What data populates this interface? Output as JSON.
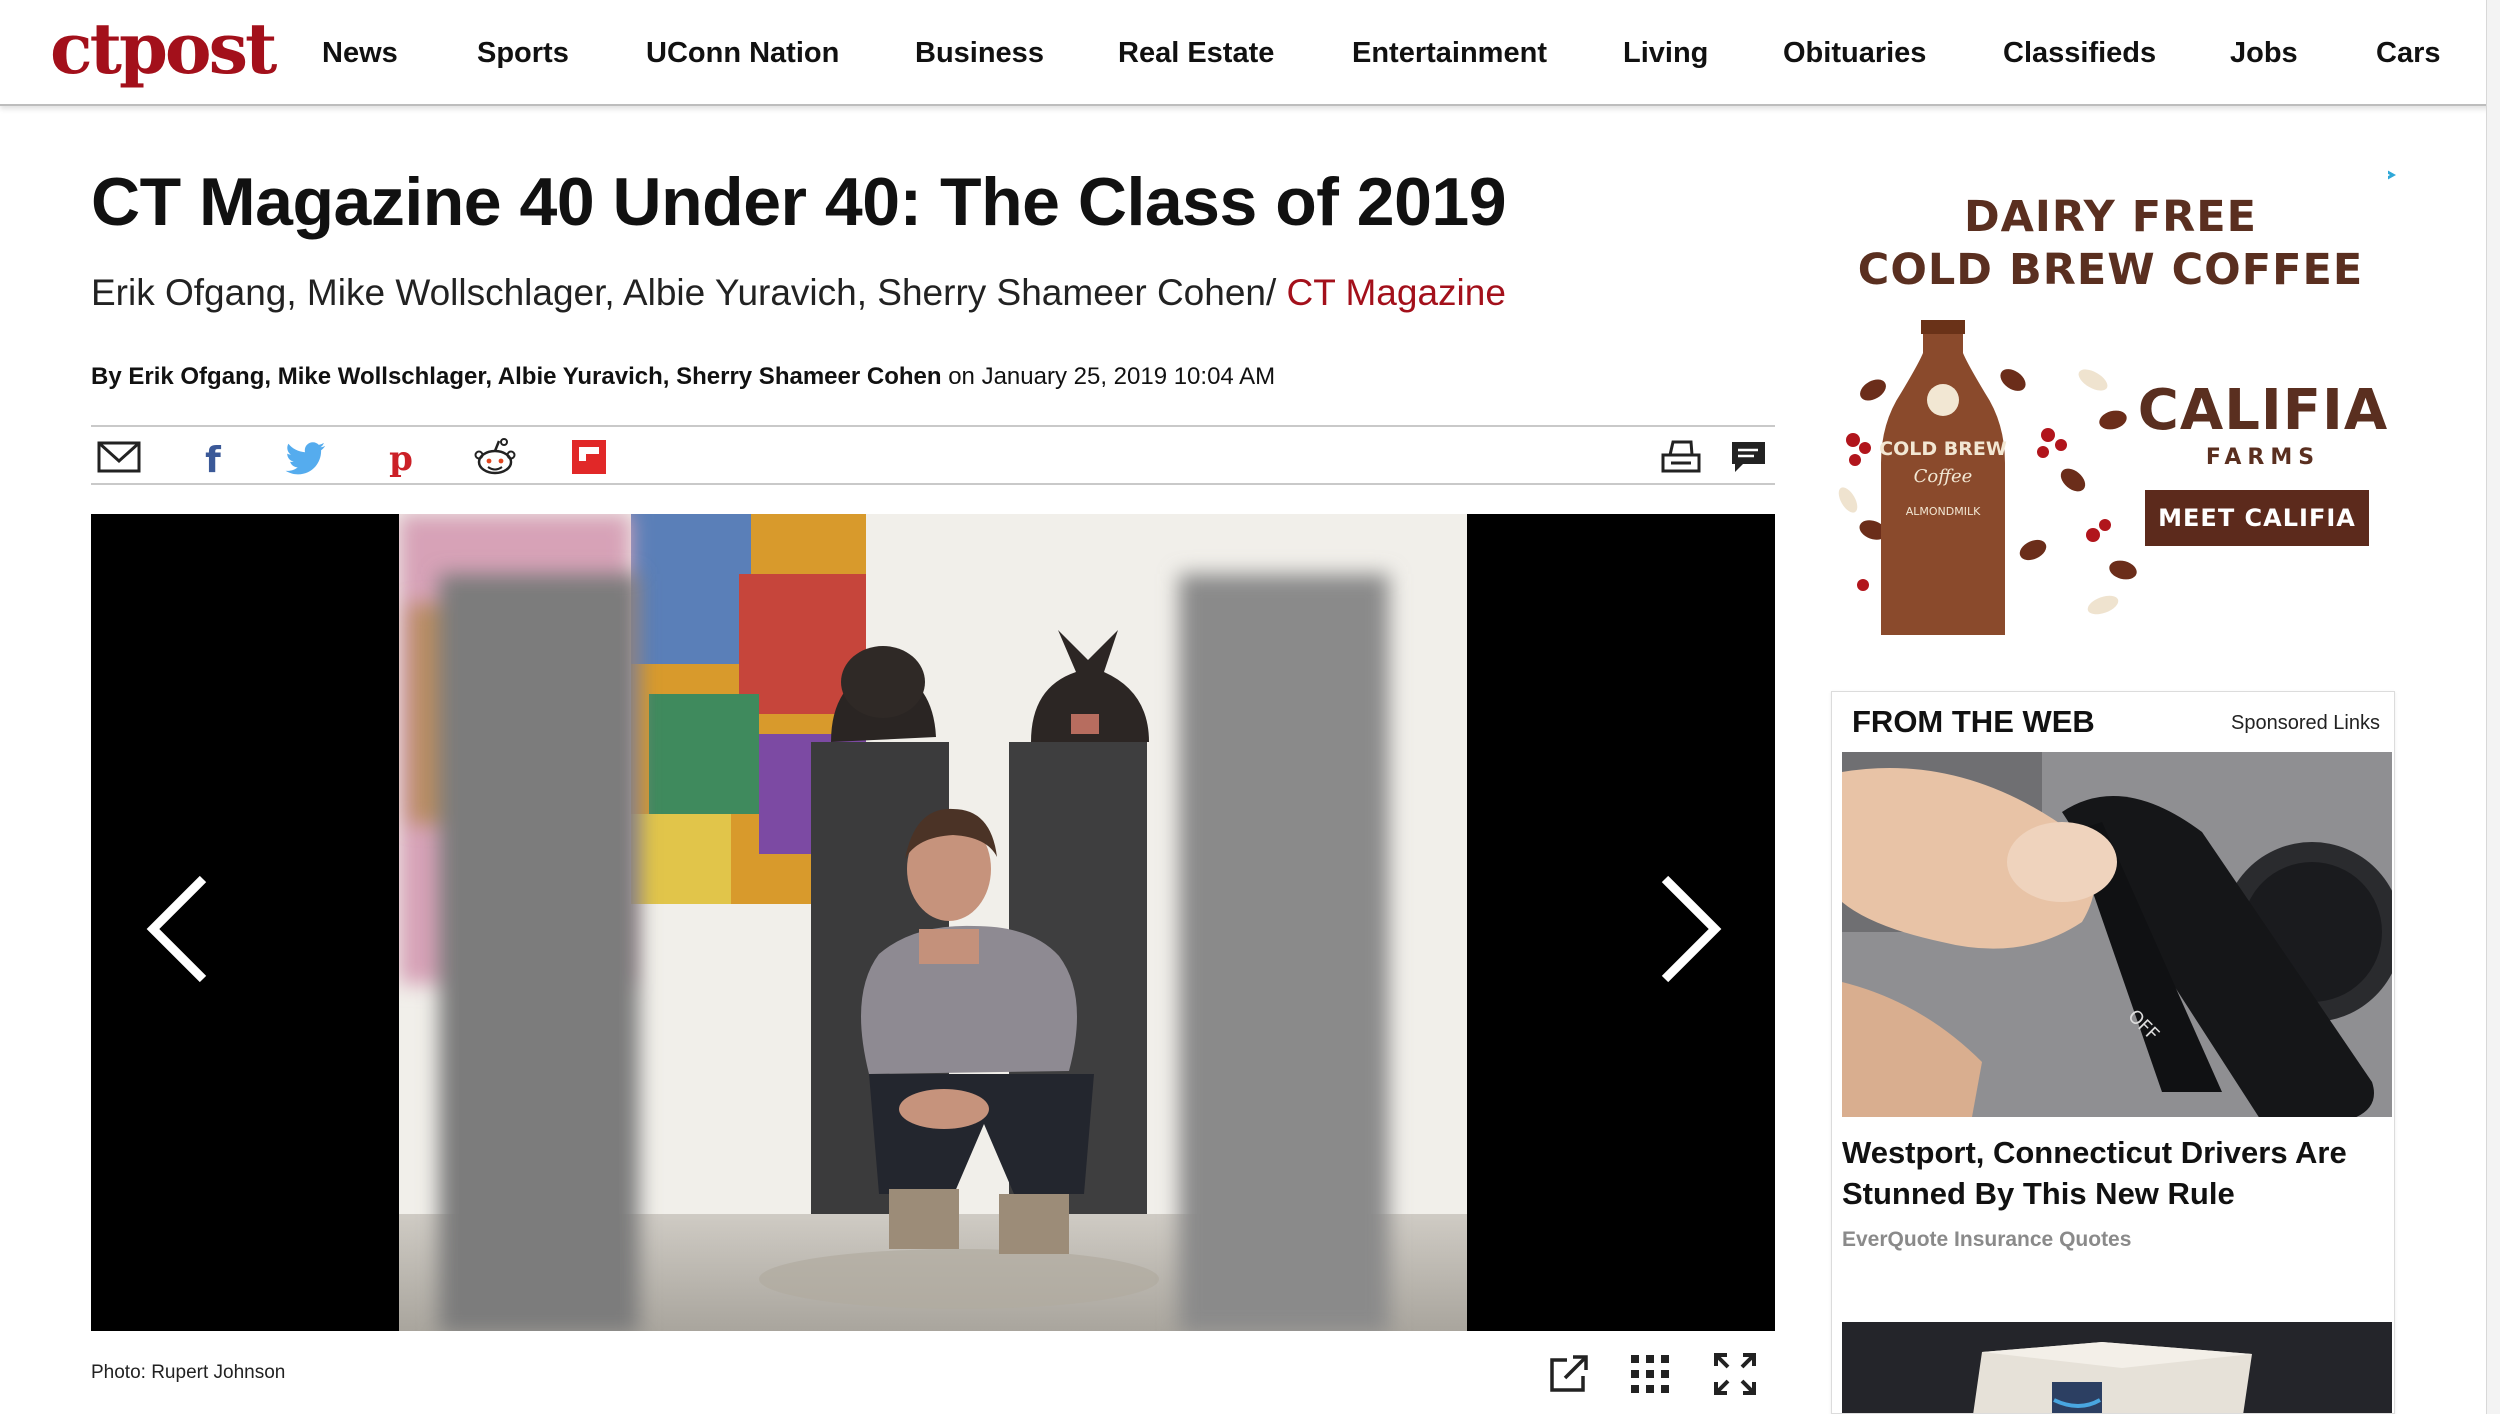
{
  "site": {
    "logo": "ctpost",
    "brand_color": "#a3101b"
  },
  "nav": {
    "items": [
      "News",
      "Sports",
      "UConn Nation",
      "Business",
      "Real Estate",
      "Entertainment",
      "Living",
      "Obituaries",
      "Classifieds",
      "Jobs",
      "Cars"
    ]
  },
  "article": {
    "headline": "CT Magazine 40 Under 40: The Class of 2019",
    "authors_line": "Erik Ofgang, Mike Wollschlager, Albie Yuravich, Sherry Shameer Cohen/",
    "section": "CT Magazine",
    "byline_prefix": "By",
    "byline_authors": "Erik Ofgang, Mike Wollschlager, Albie Yuravich, Sherry Shameer Cohen",
    "byline_date": "on January 25, 2019 10:04 AM"
  },
  "share": {
    "icons": [
      "email-icon",
      "facebook-icon",
      "twitter-icon",
      "pinterest-icon",
      "reddit-icon",
      "flipboard-icon"
    ],
    "right_icons": [
      "print-icon",
      "comments-icon"
    ]
  },
  "gallery": {
    "caption": "Photo: Rupert Johnson",
    "tools": [
      "open-external-icon",
      "grid-view-icon",
      "fullscreen-icon"
    ]
  },
  "ad": {
    "headline_1": "DAIRY FREE",
    "headline_2": "COLD BREW COFFEE",
    "brand": "CALIFIA",
    "brand_sub": "FARMS",
    "cta": "MEET CALIFIA",
    "bottle_label_1": "COLD BREW",
    "bottle_label_2": "Coffee",
    "bottle_label_3": "ALMONDMILK",
    "colors": {
      "brown": "#5a2f20",
      "cta_bg": "#5c2a1c"
    }
  },
  "from_the_web": {
    "heading": "FROM THE WEB",
    "sponsored": "Sponsored Links",
    "card_title": "Westport, Connecticut Drivers Are Stunned By This New Rule",
    "card_source": "EverQuote Insurance Quotes"
  }
}
